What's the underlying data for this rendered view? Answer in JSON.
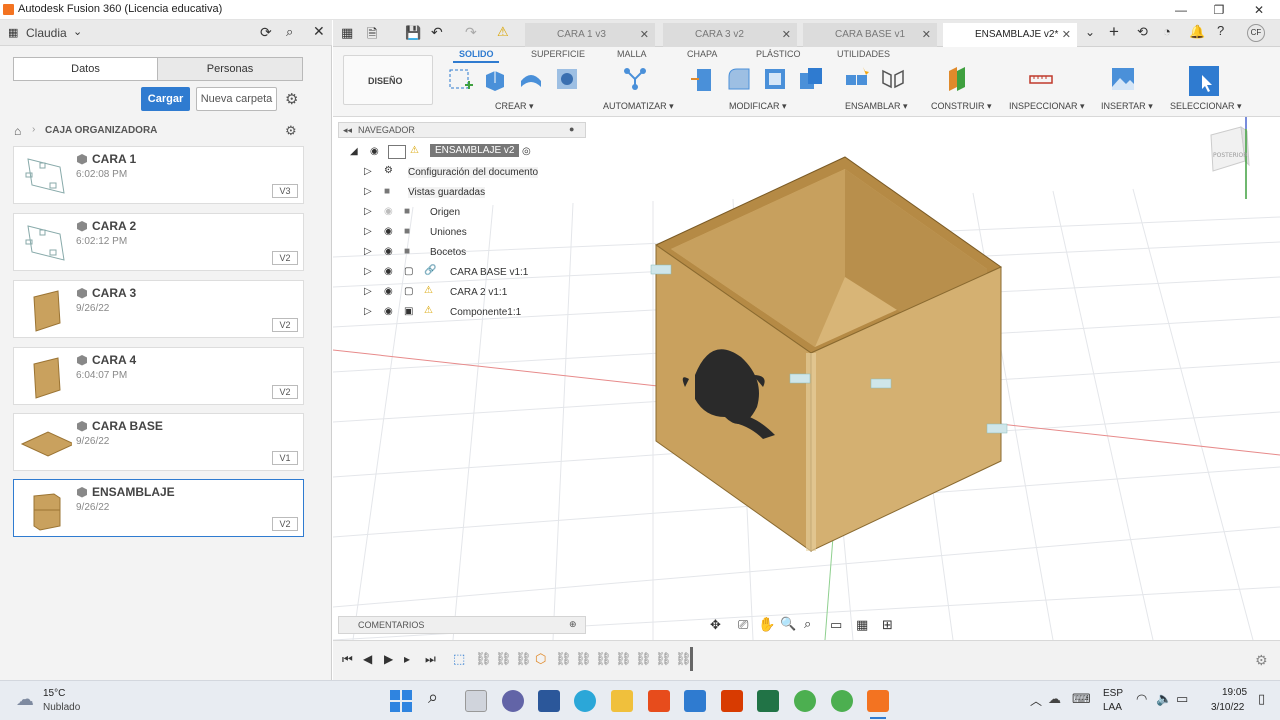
{
  "window": {
    "title": "Autodesk Fusion 360 (Licencia educativa)",
    "minimize": "—",
    "maximize": "❐",
    "close": "✕"
  },
  "left_panel": {
    "user": "Claudia",
    "tabs": [
      "Datos",
      "Personas"
    ],
    "upload_label": "Cargar",
    "new_folder_label": "Nueva carpeta",
    "breadcrumb": "CAJA ORGANIZADORA",
    "files": [
      {
        "name": "CARA 1",
        "date": "6:02:08 PM",
        "version": "V3"
      },
      {
        "name": "CARA 2",
        "date": "6:02:12 PM",
        "version": "V2"
      },
      {
        "name": "CARA 3",
        "date": "9/26/22",
        "version": "V2"
      },
      {
        "name": "CARA 4",
        "date": "6:04:07 PM",
        "version": "V2"
      },
      {
        "name": "CARA BASE",
        "date": "9/26/22",
        "version": "V1"
      },
      {
        "name": "ENSAMBLAJE",
        "date": "9/26/22",
        "version": "V2"
      }
    ]
  },
  "doc_tabs": [
    "CARA 1 v3",
    "CARA 3 v2",
    "CARA BASE v1",
    "ENSAMBLAJE v2*"
  ],
  "ribbon": {
    "workspace": "DISEÑO",
    "tabs": [
      "SOLIDO",
      "SUPERFICIE",
      "MALLA",
      "CHAPA",
      "PLÁSTICO",
      "UTILIDADES"
    ],
    "groups": [
      "CREAR",
      "AUTOMATIZAR",
      "MODIFICAR",
      "ENSAMBLAR",
      "CONSTRUIR",
      "INSPECCIONAR",
      "INSERTAR",
      "SELECCIONAR"
    ]
  },
  "navigator": {
    "title": "NAVEGADOR",
    "root": "ENSAMBLAJE v2",
    "items": [
      "Configuración del documento",
      "Vistas guardadas",
      "Origen",
      "Uniones",
      "Bocetos",
      "CARA BASE v1:1",
      "CARA 2 v1:1",
      "Componente1:1"
    ]
  },
  "viewcube_label": "POSTERIOR",
  "comments_label": "COMENTARIOS",
  "taskbar": {
    "weather_temp": "15°C",
    "weather_desc": "Nublado",
    "lang1": "ESP",
    "lang2": "LAA",
    "time": "19:05",
    "date": "3/10/22"
  },
  "colors": {
    "accent": "#2f7bd0",
    "wood": "#c9a15e",
    "wood_dark": "#9b7433"
  }
}
